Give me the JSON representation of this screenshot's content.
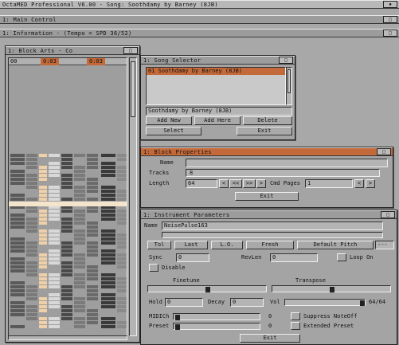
{
  "app": {
    "title": "OctaMED Professional V6.00 - Song: Soothdamy by Barney (8JB)",
    "main_control": "1: Main Control",
    "information": "1: Information - (Tempo = SPD 36/52)"
  },
  "block_arts": {
    "title": "1: Block Arts - Co",
    "header_cells": [
      "00",
      "0:03",
      "0:03"
    ]
  },
  "song_selector": {
    "title": "1: Song Selector",
    "items": [
      "01 Soothdamy by Barney (8JB)"
    ],
    "current": "Soothdamy by Barney (8JB)",
    "buttons": {
      "add_new": "Add New",
      "add_here": "Add Here",
      "delete": "Delete",
      "select": "Select",
      "exit": "Exit"
    }
  },
  "block_properties": {
    "title": "1: Block Properties",
    "name_label": "Name",
    "tracks_label": "Tracks",
    "tracks_value": "8",
    "length_label": "Length",
    "length_value": "64",
    "buttons": [
      "<",
      "<<",
      ">>",
      ">"
    ],
    "cmd_pages_label": "Cmd Pages",
    "cmd_pages_value": "1",
    "exit": "Exit"
  },
  "instrument_params": {
    "title": "1: Instrument Parameters",
    "name_label": "Name",
    "name_value": "NoisePulse163",
    "buttons": {
      "tol": "Tol",
      "last": "Last",
      "lo": "L.O.",
      "fresh": "Fresh",
      "default_pitch": "Default Pitch"
    },
    "default_pitch_value": "---",
    "sync": "Sync",
    "sync_value": "0",
    "disable": "Disable",
    "revlen_label": "RevLen",
    "revlen_value": "0",
    "loop_on": "Loop On",
    "finetune": "Finetune",
    "transpose": "Transpose",
    "hold_label": "Hold",
    "hold_value": "0",
    "decay_label": "Decay",
    "decay_value": "0",
    "vol_label": "Vol",
    "vol_value": "64/64",
    "midich_label": "MIDICh",
    "midich_value": "0",
    "preset_label": "Preset",
    "preset_value": "0",
    "suppress": "Suppress NoteOff",
    "extended": "Extended Preset",
    "exit": "Exit"
  }
}
